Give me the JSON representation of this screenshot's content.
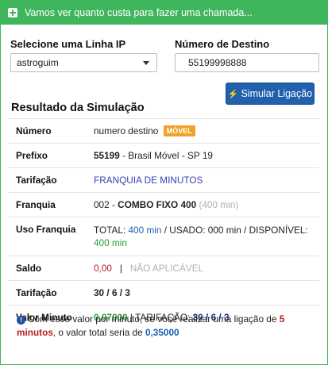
{
  "header": {
    "title": "Vamos ver quanto custa para fazer uma chamada..."
  },
  "form": {
    "line_label": "Selecione uma Linha IP",
    "line_value": "astroguim",
    "dest_label": "Número de Destino",
    "dest_value": "55199998888",
    "simulate_button": "Simular Ligação"
  },
  "results": {
    "title": "Resultado da Simulação",
    "numero": {
      "label": "Número",
      "value": "numero destino",
      "badge": "MÓVEL"
    },
    "prefixo": {
      "label": "Prefixo",
      "code": "55199",
      "desc": " - Brasil Móvel - SP 19"
    },
    "tarifacao1": {
      "label": "Tarifação",
      "value": "FRANQUIA DE MINUTOS"
    },
    "franquia": {
      "label": "Franquia",
      "code": "002 - ",
      "name": "COMBO FIXO 400",
      "minutes": "(400 min)"
    },
    "uso_franquia": {
      "label": "Uso Franquia",
      "total_label": "TOTAL: ",
      "total_value": "400 min",
      "sep1": " / USADO: 000 min / DISPONÍVEL: ",
      "available_value": "400 min"
    },
    "saldo": {
      "label": "Saldo",
      "value": "0,00",
      "separator": "|",
      "status": "NÃO APLICÁVEL"
    },
    "tarifacao2": {
      "label": "Tarifação",
      "value": "30 / 6 / 3"
    },
    "valor_minuto": {
      "label": "Valor Minuto",
      "value": "0,07000",
      "tarif_label": " | TARIFAÇÃO: ",
      "tarif_value": "30 / 6 / 3"
    }
  },
  "note": {
    "part1": "Com esse valor por minuto, se você realizar uma ligação de ",
    "minutes": "5 minutos",
    "part2": ", o valor total seria de ",
    "total": "0,35000"
  },
  "colors": {
    "header_green": "#3fb55c",
    "button_blue": "#2060ad",
    "badge_orange": "#f0a22b"
  },
  "icons": {
    "header": "plus-square-icon",
    "button": "bolt-icon",
    "note": "info-circle-icon"
  }
}
